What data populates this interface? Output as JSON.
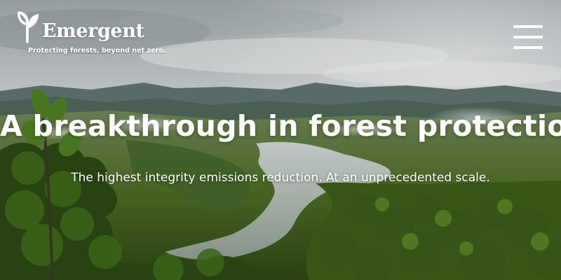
{
  "header": {
    "logo": {
      "icon": "tree-leaf-logo-icon",
      "wordmark": "Emergent"
    },
    "tagline": "Protecting forests, beyond net zero.",
    "menu_icon": "hamburger-menu-icon"
  },
  "hero": {
    "headline": "A breakthrough in forest protection",
    "subheadline": "The highest integrity emissions reduction. At an unprecedented scale.",
    "background_image": "aerial rainforest landscape with a winding river and distant mountains under a cloudy sky"
  },
  "colors": {
    "text": "#ffffff",
    "sky": "#c7cccf",
    "mountains": "#5c6f6e",
    "forest": "#3f5d1f",
    "river": "#a8b5b2"
  }
}
